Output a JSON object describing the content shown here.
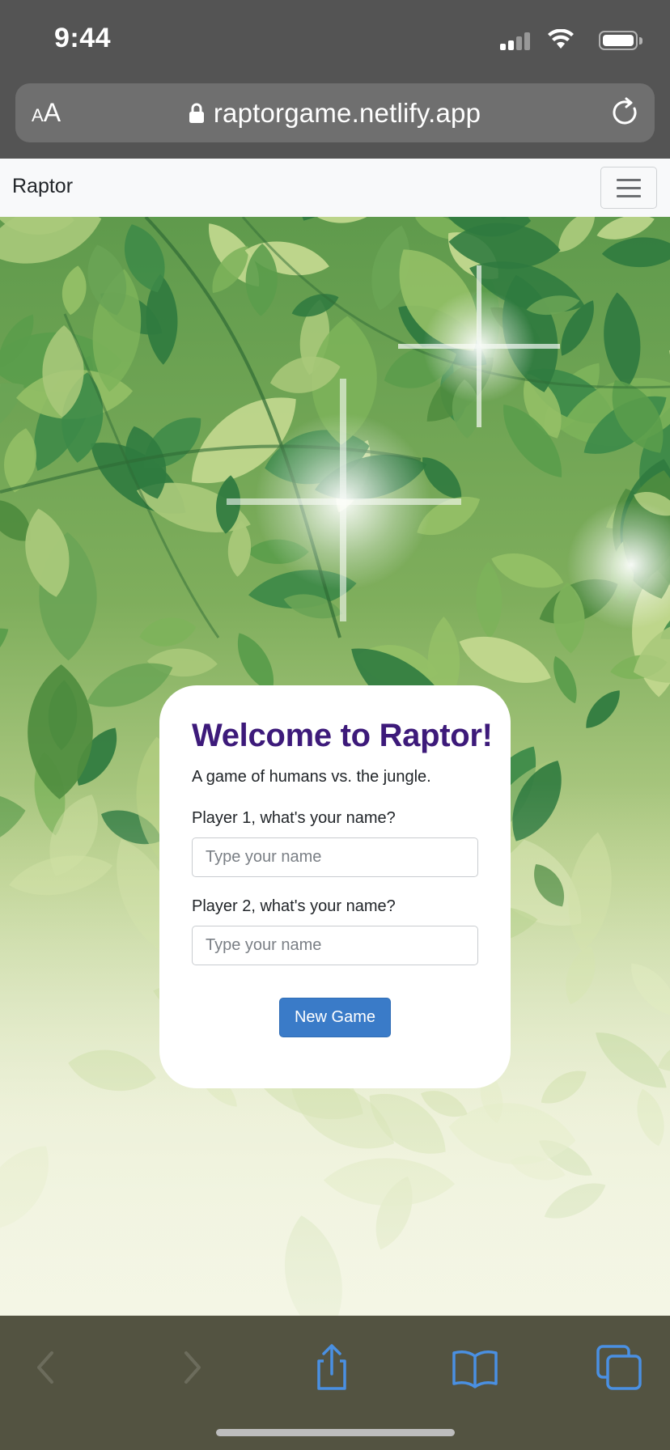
{
  "status_bar": {
    "time": "9:44",
    "icons": [
      "cellular-signal-icon",
      "wifi-icon",
      "battery-icon"
    ]
  },
  "address_bar": {
    "text_size_label_small": "A",
    "text_size_label_large": "A",
    "url": "raptorgame.netlify.app",
    "icons": [
      "lock-icon",
      "reload-icon"
    ]
  },
  "navbar": {
    "brand": "Raptor",
    "toggler_icon": "hamburger-menu-icon"
  },
  "card": {
    "title": "Welcome to Raptor!",
    "subtitle": "A game of humans vs. the jungle.",
    "player1_label": "Player 1, what's your name?",
    "player1_placeholder": "Type your name",
    "player1_value": "",
    "player2_label": "Player 2, what's your name?",
    "player2_placeholder": "Type your name",
    "player2_value": "",
    "button_label": "New Game"
  },
  "toolbar": {
    "icons": [
      "back-icon",
      "forward-icon",
      "share-icon",
      "bookmarks-icon",
      "tabs-icon"
    ],
    "back_enabled": false,
    "forward_enabled": false
  },
  "colors": {
    "title": "#3d1a7a",
    "button": "#3a7bc8",
    "safari_chrome": "#545454",
    "toolbar": "#535341",
    "toolbar_icon": "#4a90e2"
  }
}
